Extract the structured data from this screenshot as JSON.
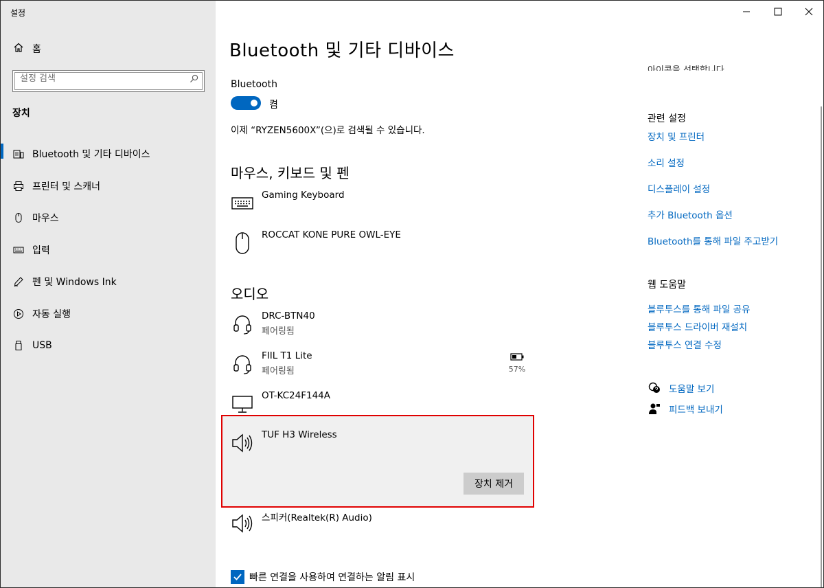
{
  "app_title": "설정",
  "sidebar": {
    "home_label": "홈",
    "search_placeholder": "설정 검색",
    "section": "장치",
    "items": [
      {
        "label": "Bluetooth 및 기타 디바이스",
        "icon": "bluetooth-devices-icon"
      },
      {
        "label": "프린터 및 스캐너",
        "icon": "printer-icon"
      },
      {
        "label": "마우스",
        "icon": "mouse-icon"
      },
      {
        "label": "입력",
        "icon": "keyboard-icon"
      },
      {
        "label": "펜 및 Windows Ink",
        "icon": "pen-icon"
      },
      {
        "label": "자동 실행",
        "icon": "autoplay-icon"
      },
      {
        "label": "USB",
        "icon": "usb-icon"
      }
    ]
  },
  "main": {
    "title": "Bluetooth 및 기타 디바이스",
    "bluetooth_label": "Bluetooth",
    "toggle_state": "켬",
    "discover_text": "이제 “RYZEN5600X”(으)로 검색될 수 있습니다.",
    "groups": {
      "input_head": "마우스, 키보드 및 펜",
      "audio_head": "오디오"
    },
    "input_devices": [
      {
        "name": "Gaming Keyboard",
        "icon": "keyboard-icon"
      },
      {
        "name": "ROCCAT KONE PURE OWL-EYE",
        "icon": "mouse-icon"
      }
    ],
    "audio_devices": [
      {
        "name": "DRC-BTN40",
        "status": "페어링됨",
        "icon": "headset-icon"
      },
      {
        "name": "FIIL T1 Lite",
        "status": "페어링됨",
        "icon": "headset-icon",
        "battery": "57%"
      },
      {
        "name": "OT-KC24F144A",
        "icon": "monitor-icon"
      },
      {
        "name": "TUF H3 Wireless",
        "icon": "speaker-icon",
        "selected": true
      },
      {
        "name": "스피커(Realtek(R) Audio)",
        "icon": "speaker-icon"
      }
    ],
    "remove_button": "장치 제거",
    "swift_pair_label": "빠른 연결을 사용하여 연결하는 알림 표시",
    "swift_pair_checked": true
  },
  "right": {
    "clipped_text": "아이콘을 선택합니다.",
    "related_head": "관련 설정",
    "related_links": [
      "장치 및 프린터",
      "소리 설정",
      "디스플레이 설정",
      "추가 Bluetooth 옵션",
      "Bluetooth를 통해 파일 주고받기"
    ],
    "web_help_head": "웹 도움말",
    "web_help_links": [
      "블루투스를 통해 파일 공유",
      "블루투스 드라이버 재설치",
      "블루투스 연결 수정"
    ],
    "help_items": [
      {
        "label": "도움말 보기",
        "icon": "help-chat-icon"
      },
      {
        "label": "피드백 보내기",
        "icon": "feedback-icon"
      }
    ]
  },
  "window_controls": [
    "minimize",
    "maximize",
    "close"
  ],
  "colors": {
    "accent": "#0067c0",
    "highlight_border": "#e00000",
    "sidebar_bg": "#e9e9e9"
  }
}
